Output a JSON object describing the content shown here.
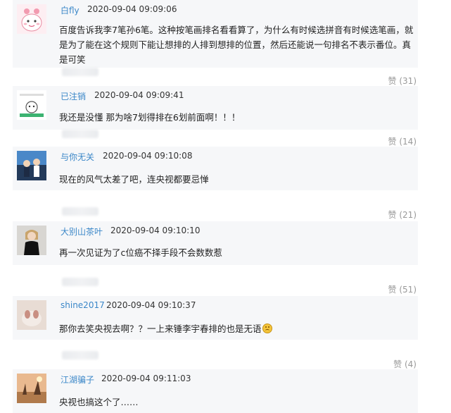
{
  "comments": [
    {
      "author": "白fly",
      "time": "2020-09-04 09:09:06",
      "text": "百度告诉我李7笔孙6笔。这种按笔画排名看看算了，为什么有时候选拼音有时候选笔画，就是为了能在这个规则下能让想排的人排到想排的位置，然后还能说一句排名不表示番位。真是可笑",
      "likes": "赞 (31)"
    },
    {
      "author": "已注销",
      "time": "2020-09-04 09:09:41",
      "text": "我还是没懂 那为啥7划得排在6划前面啊！！！",
      "likes": "赞 (14)"
    },
    {
      "author": "与你无关",
      "time": "2020-09-04 09:10:08",
      "text": "现在的风气太差了吧，连央视都要忌惮",
      "likes": "赞 (21)"
    },
    {
      "author": "大别山茶叶",
      "time": "2020-09-04 09:10:10",
      "text": "再一次见证为了c位癌不择手段不会数数惹",
      "likes": "赞 (51)"
    },
    {
      "author": "shine2017",
      "time": "2020-09-04 09:10:37",
      "text": "那你去笑央视去啊？？一上来锤李宇春排的也是无语",
      "emoji": "sad-face-emoji",
      "likes": "赞 (4)"
    },
    {
      "author": "江湖骗子",
      "time": "2020-09-04 09:11:03",
      "text": "央视也搞这个了……",
      "likes": ""
    }
  ],
  "colors": {
    "author": "#3b87c8",
    "box": "#f6f7f9",
    "muted": "#999999"
  }
}
